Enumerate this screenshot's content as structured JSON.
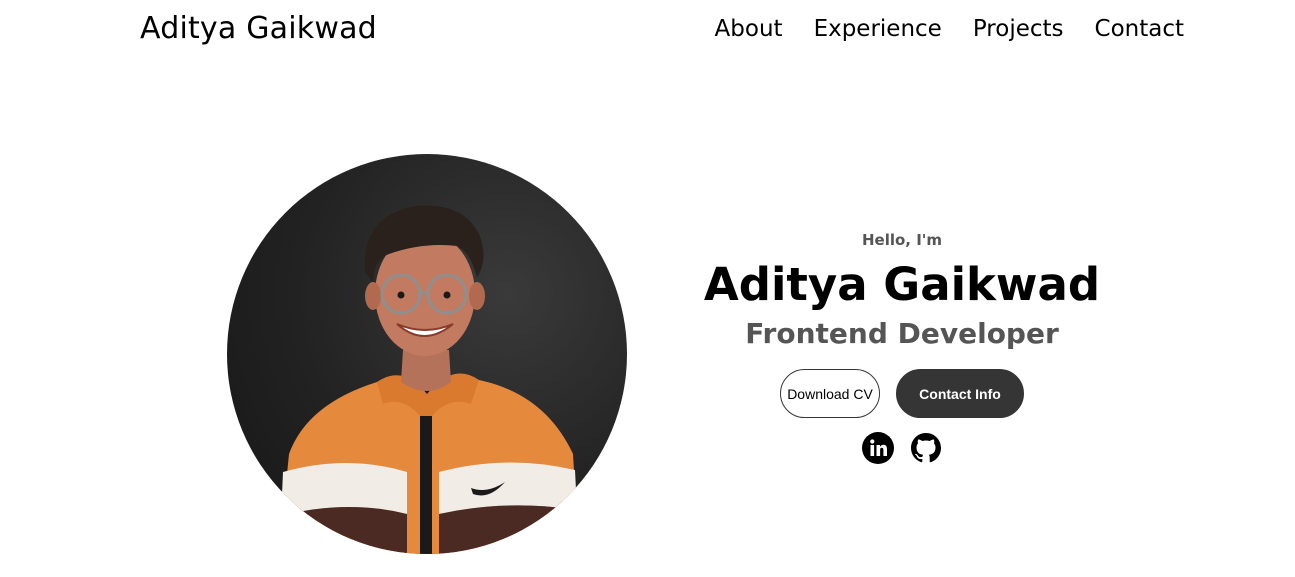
{
  "nav": {
    "logo": "Aditya Gaikwad",
    "links": [
      "About",
      "Experience",
      "Projects",
      "Contact"
    ]
  },
  "hero": {
    "greeting": "Hello, I'm",
    "name": "Aditya Gaikwad",
    "title": "Frontend Developer",
    "buttons": {
      "download_cv": "Download CV",
      "contact_info": "Contact Info"
    },
    "socials": [
      {
        "icon": "linkedin-icon"
      },
      {
        "icon": "github-icon"
      }
    ]
  },
  "colors": {
    "text": "#000000",
    "muted": "#555555",
    "button_dark": "#353535",
    "background": "#ffffff"
  }
}
